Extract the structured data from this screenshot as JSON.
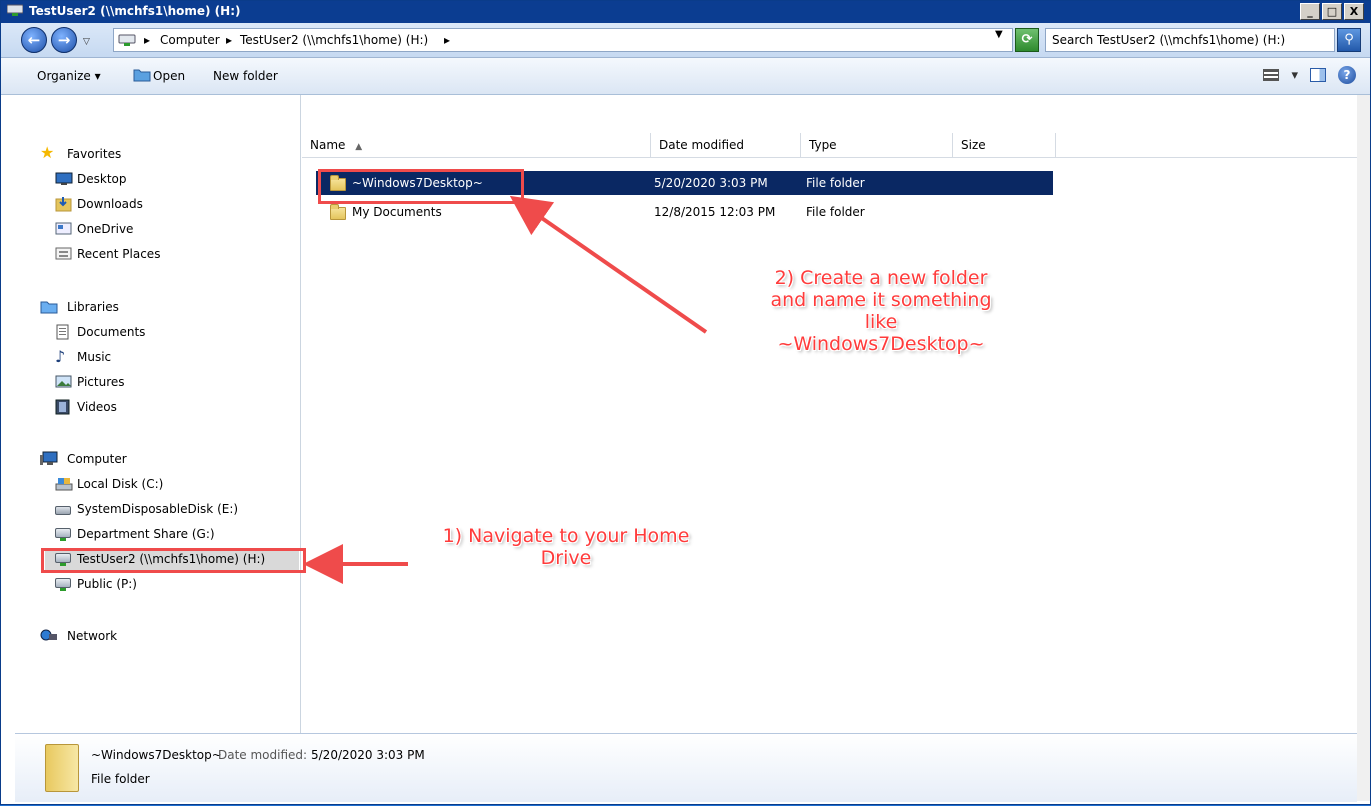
{
  "window": {
    "title": "TestUser2 (\\\\mchfs1\\home) (H:)",
    "buttons": {
      "minimize": "_",
      "maximize": "□",
      "close": "X"
    }
  },
  "address": {
    "crumbs": [
      "Computer",
      "TestUser2 (\\\\mchfs1\\home) (H:)"
    ],
    "search_placeholder": "Search TestUser2 (\\\\mchfs1\\home) (H:)"
  },
  "commands": {
    "organize": "Organize",
    "open": "Open",
    "new_folder": "New folder"
  },
  "nav": {
    "favorites": "Favorites",
    "fav_items": [
      "Desktop",
      "Downloads",
      "OneDrive",
      "Recent Places"
    ],
    "libraries": "Libraries",
    "lib_items": [
      "Documents",
      "Music",
      "Pictures",
      "Videos"
    ],
    "computer": "Computer",
    "comp_items": [
      "Local Disk (C:)",
      "SystemDisposableDisk (E:)",
      "Department Share (G:)",
      "TestUser2 (\\\\mchfs1\\home) (H:)",
      "Public (P:)"
    ],
    "network": "Network"
  },
  "columns": {
    "name": "Name",
    "date": "Date modified",
    "type": "Type",
    "size": "Size"
  },
  "files": [
    {
      "name": "~Windows7Desktop~",
      "date": "5/20/2020 3:03 PM",
      "type": "File folder"
    },
    {
      "name": "My Documents",
      "date": "12/8/2015 12:03 PM",
      "type": "File folder"
    }
  ],
  "details": {
    "name": "~Windows7Desktop~",
    "modified_label": "Date modified:",
    "modified_value": "5/20/2020 3:03 PM",
    "type": "File folder"
  },
  "annotations": {
    "step1_line1": "1) Navigate to your Home",
    "step1_line2": "Drive",
    "step2_line1": "2) Create a new folder",
    "step2_line2": "and name it something",
    "step2_line3": "like",
    "step2_line4": "~Windows7Desktop~"
  },
  "colors": {
    "annotation": "#ff3b3b",
    "selection": "#0a2863",
    "titlebar": "#0b3d91"
  }
}
